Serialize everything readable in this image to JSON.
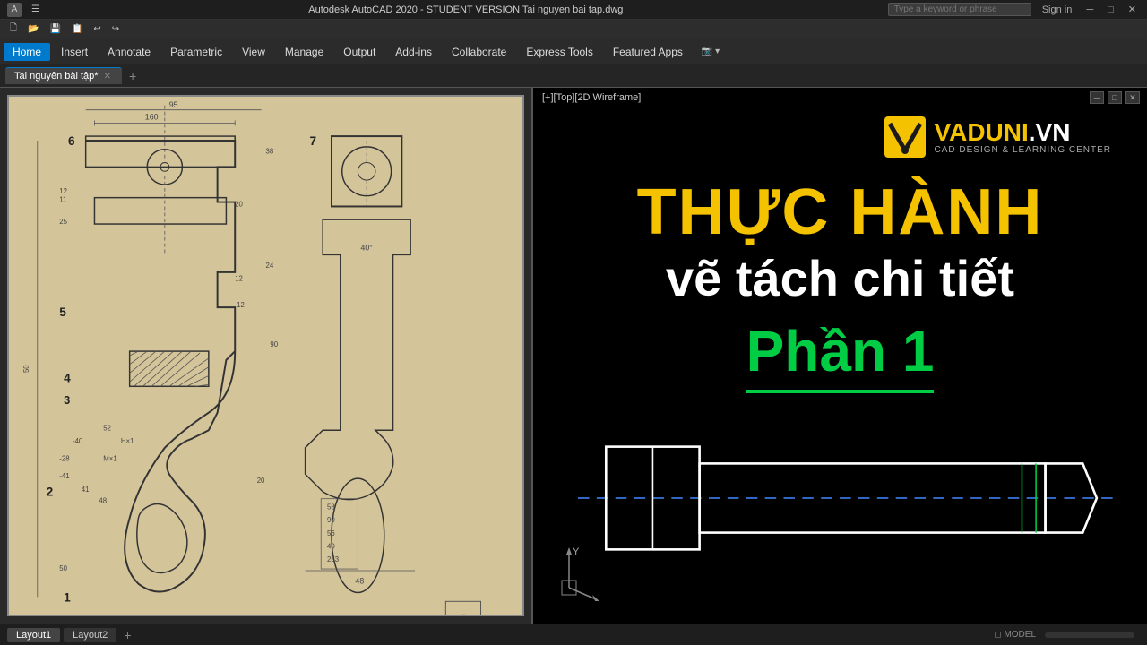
{
  "titlebar": {
    "title": "Autodesk AutoCAD 2020 - STUDENT VERSION  Tai nguyen bai tap.dwg",
    "search_placeholder": "Type a keyword or phrase",
    "sign_in": "Sign in",
    "minimize": "─",
    "restore": "□",
    "close": "✕"
  },
  "menubar": {
    "items": [
      "Home",
      "Insert",
      "Annotate",
      "Parametric",
      "View",
      "Manage",
      "Output",
      "Add-ins",
      "Collaborate",
      "Express Tools",
      "Featured Apps"
    ],
    "active": "Home"
  },
  "tabbar": {
    "tabs": [
      {
        "label": "Tai nguyên bài tập*",
        "active": true
      }
    ],
    "add_label": "+"
  },
  "left_panel": {
    "viewport_label": ""
  },
  "right_panel": {
    "viewport_label": "[+][Top][2D Wireframe]",
    "logo_name": "VADUNI",
    "logo_dot": ".VN",
    "logo_sub": "CAD DESIGN & LEARNING CENTER",
    "title_line1": "THỰC HÀNH",
    "title_line2": "vẽ tách chi tiết",
    "title_line3": "Phần 1"
  },
  "statusbar": {
    "layouts": [
      "Layout1",
      "Layout2"
    ],
    "add_label": "+"
  },
  "icons": {
    "minimize": "─",
    "maximize": "□",
    "close": "✕",
    "chevron": "▾"
  }
}
